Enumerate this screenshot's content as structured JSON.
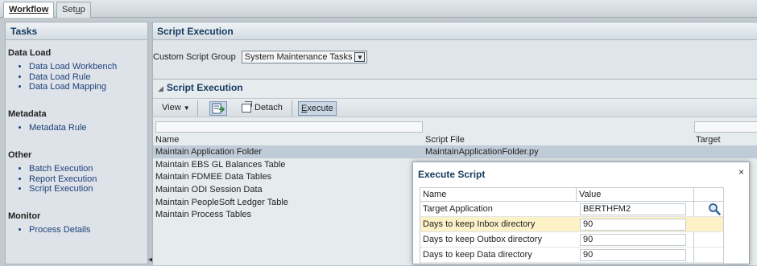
{
  "tabs": [
    {
      "label": "Workflow",
      "active": true
    },
    {
      "label_prefix": "Set",
      "label_underlined": "u",
      "label_suffix": "p",
      "active": false
    }
  ],
  "tasks": {
    "title": "Tasks",
    "groups": [
      {
        "heading": "Data Load",
        "items": [
          "Data Load Workbench",
          "Data Load Rule",
          "Data Load Mapping"
        ]
      },
      {
        "heading": "Metadata",
        "items": [
          "Metadata Rule"
        ]
      },
      {
        "heading": "Other",
        "items": [
          "Batch Execution",
          "Report Execution",
          "Script Execution"
        ]
      },
      {
        "heading": "Monitor",
        "items": [
          "Process Details"
        ]
      }
    ]
  },
  "main": {
    "title": "Script Execution",
    "custom_group_label": "Custom Script Group",
    "custom_group_value": "System Maintenance Tasks",
    "panel": {
      "title": "Script Execution",
      "toolbar": {
        "view": "View",
        "detach": "Detach",
        "execute_prefix": "",
        "execute_underlined": "E",
        "execute_suffix": "xecute"
      },
      "columns": [
        "Name",
        "Script File",
        "Target"
      ],
      "rows": [
        {
          "name": "Maintain Application Folder",
          "file": "MaintainApplicationFolder.py",
          "selected": true
        },
        {
          "name": "Maintain EBS GL Balances Table",
          "file": ""
        },
        {
          "name": "Maintain FDMEE Data Tables",
          "file": ""
        },
        {
          "name": "Maintain ODI Session Data",
          "file": ""
        },
        {
          "name": "Maintain PeopleSoft Ledger Table",
          "file": ""
        },
        {
          "name": "Maintain Process Tables",
          "file": ""
        }
      ]
    }
  },
  "dialog": {
    "title": "Execute Script",
    "close": "×",
    "columns": [
      "Name",
      "Value"
    ],
    "rows": [
      {
        "name": "Target Application",
        "value": "BERTHFM2"
      },
      {
        "name": "Days to keep Inbox directory",
        "value": "90"
      },
      {
        "name": "Days to keep Outbox directory",
        "value": "90"
      },
      {
        "name": "Days to keep Data directory",
        "value": "90"
      }
    ]
  },
  "colors": {
    "accent_title": "#163b60",
    "link": "#1f3f7a",
    "highlight_row": "#fdf1c8",
    "selected_row": "#bfcbd6"
  },
  "icons": [
    "search-icon",
    "chevron-down-icon",
    "collapse-triangle-icon",
    "detach-icon",
    "execute-icon",
    "close-icon"
  ]
}
